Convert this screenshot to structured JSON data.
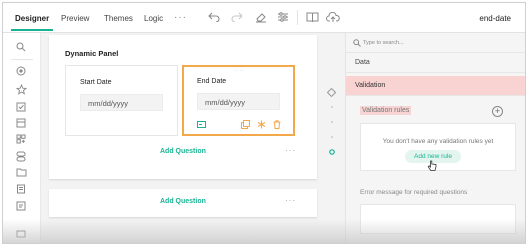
{
  "tabs": [
    {
      "label": "Designer",
      "active": true
    },
    {
      "label": "Preview"
    },
    {
      "label": "Themes"
    },
    {
      "label": "Logic"
    }
  ],
  "more_menu": "···",
  "header_title": "end-date",
  "toolbox_icons": [
    "search-icon",
    "radio-icon",
    "star-icon",
    "checkbox-icon",
    "dropdown-icon",
    "grid-icon",
    "boolean-icon",
    "folder-icon",
    "file-icon",
    "text-icon",
    "panel-icon"
  ],
  "panel": {
    "title": "Dynamic Panel",
    "questions": [
      {
        "title": "Start Date",
        "placeholder": "mm/dd/yyyy"
      },
      {
        "title": "End Date",
        "placeholder": "mm/dd/yyyy",
        "selected": true
      }
    ],
    "add_question": "Add Question",
    "more": "···"
  },
  "second_card": {
    "add_question": "Add Question",
    "more": "···"
  },
  "properties": {
    "search_placeholder": "Type to search...",
    "categories": [
      "Data",
      "Validation"
    ],
    "active_category": "Validation",
    "validation_rules_label": "Validation rules",
    "empty_message": "You don't have any validation rules yet",
    "add_rule_button": "Add new rule",
    "error_message_label": "Error message for required questions"
  },
  "colors": {
    "accent": "#19b394",
    "selection": "#f3a84b",
    "highlight": "#f9d2d2"
  }
}
